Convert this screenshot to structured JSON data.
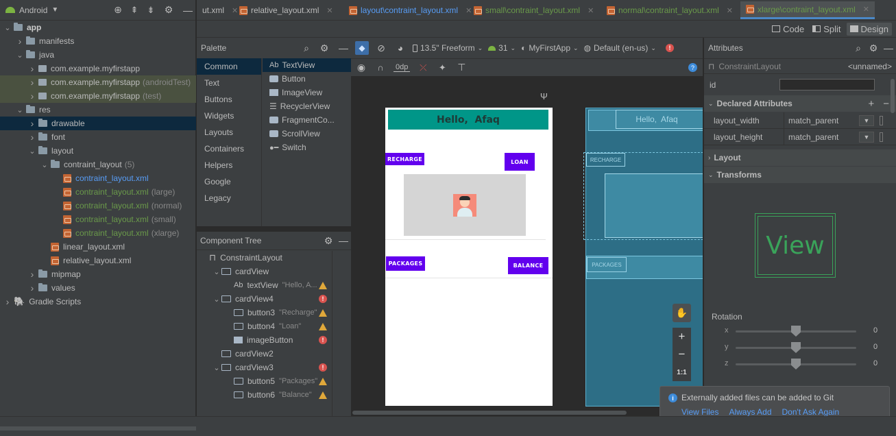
{
  "project": {
    "view": "Android",
    "tree": [
      {
        "label": "app",
        "d": 0,
        "arrow": "v",
        "icon": "folder",
        "bold": true
      },
      {
        "label": "manifests",
        "d": 1,
        "arrow": ">",
        "icon": "folder"
      },
      {
        "label": "java",
        "d": 1,
        "arrow": "v",
        "icon": "folder"
      },
      {
        "label": "com.example.myfirstapp",
        "d": 2,
        "arrow": ">",
        "icon": "pkg"
      },
      {
        "label": "com.example.myfirstapp",
        "suffix": "(androidTest)",
        "d": 2,
        "arrow": ">",
        "icon": "pkg",
        "hl": "test"
      },
      {
        "label": "com.example.myfirstapp",
        "suffix": "(test)",
        "d": 2,
        "arrow": ">",
        "icon": "pkg",
        "hl": "test"
      },
      {
        "label": "res",
        "d": 1,
        "arrow": "v",
        "icon": "folder"
      },
      {
        "label": "drawable",
        "d": 2,
        "arrow": ">",
        "icon": "folder",
        "hl": "sel"
      },
      {
        "label": "font",
        "d": 2,
        "arrow": ">",
        "icon": "folder"
      },
      {
        "label": "layout",
        "d": 2,
        "arrow": "v",
        "icon": "folder"
      },
      {
        "label": "contraint_layout",
        "suffix": "(5)",
        "d": 3,
        "arrow": "v",
        "icon": "folder"
      },
      {
        "label": "contraint_layout.xml",
        "d": 4,
        "arrow": "",
        "icon": "xml",
        "color": "blue"
      },
      {
        "label": "contraint_layout.xml",
        "suffix": "(large)",
        "d": 4,
        "arrow": "",
        "icon": "xml",
        "color": "green"
      },
      {
        "label": "contraint_layout.xml",
        "suffix": "(normal)",
        "d": 4,
        "arrow": "",
        "icon": "xml",
        "color": "green"
      },
      {
        "label": "contraint_layout.xml",
        "suffix": "(small)",
        "d": 4,
        "arrow": "",
        "icon": "xml",
        "color": "green"
      },
      {
        "label": "contraint_layout.xml",
        "suffix": "(xlarge)",
        "d": 4,
        "arrow": "",
        "icon": "xml",
        "color": "green"
      },
      {
        "label": "linear_layout.xml",
        "d": 3,
        "arrow": "",
        "icon": "xml"
      },
      {
        "label": "relative_layout.xml",
        "d": 3,
        "arrow": "",
        "icon": "xml"
      },
      {
        "label": "mipmap",
        "d": 2,
        "arrow": ">",
        "icon": "folder"
      },
      {
        "label": "values",
        "d": 2,
        "arrow": ">",
        "icon": "folder"
      },
      {
        "label": "Gradle Scripts",
        "d": 0,
        "arrow": ">",
        "icon": "gradle"
      }
    ]
  },
  "tabs": [
    {
      "label": "ut.xml",
      "color": "#bbbbbb"
    },
    {
      "label": "relative_layout.xml",
      "color": "#bbbbbb"
    },
    {
      "label": "layout\\contraint_layout.xml",
      "color": "#589df6"
    },
    {
      "label": "small\\contraint_layout.xml",
      "color": "#6a9a4a"
    },
    {
      "label": "normal\\contraint_layout.xml",
      "color": "#6a9a4a"
    },
    {
      "label": "xlarge\\contraint_layout.xml",
      "color": "#6a9a4a",
      "active": true
    }
  ],
  "modes": {
    "code": "Code",
    "split": "Split",
    "design": "Design"
  },
  "palette": {
    "title": "Palette",
    "categories": [
      "Common",
      "Text",
      "Buttons",
      "Widgets",
      "Layouts",
      "Containers",
      "Helpers",
      "Google",
      "Legacy"
    ],
    "items": [
      "TextView",
      "Button",
      "ImageView",
      "RecyclerView",
      "FragmentCo...",
      "ScrollView",
      "Switch"
    ],
    "textview_prefix": "Ab"
  },
  "toolbar": {
    "device": "13.5\" Freeform",
    "api": "31",
    "app": "MyFirstApp",
    "locale": "Default (en-us)",
    "margin": "0dp"
  },
  "component_tree": {
    "title": "Component Tree",
    "items": [
      {
        "label": "ConstraintLayout",
        "d": 0,
        "arrow": "",
        "icon": "cl"
      },
      {
        "label": "cardView",
        "d": 1,
        "arrow": "v",
        "icon": "box"
      },
      {
        "label": "textView",
        "hint": "\"Hello, A...",
        "d": 2,
        "arrow": "",
        "icon": "ab",
        "status": "warn"
      },
      {
        "label": "cardView4",
        "d": 1,
        "arrow": "v",
        "icon": "box",
        "status": "err"
      },
      {
        "label": "button3",
        "hint": "\"Recharge\"",
        "d": 2,
        "arrow": "",
        "icon": "box",
        "status": "warn"
      },
      {
        "label": "button4",
        "hint": "\"Loan\"",
        "d": 2,
        "arrow": "",
        "icon": "box",
        "status": "warn"
      },
      {
        "label": "imageButton",
        "d": 2,
        "arrow": "",
        "icon": "img",
        "status": "err"
      },
      {
        "label": "cardView2",
        "d": 1,
        "arrow": "",
        "icon": "box"
      },
      {
        "label": "cardView3",
        "d": 1,
        "arrow": "v",
        "icon": "box",
        "status": "err"
      },
      {
        "label": "button5",
        "hint": "\"Packages\"",
        "d": 2,
        "arrow": "",
        "icon": "box",
        "status": "warn"
      },
      {
        "label": "button6",
        "hint": "\"Balance\"",
        "d": 2,
        "arrow": "",
        "icon": "box",
        "status": "warn"
      }
    ]
  },
  "design": {
    "hello": "Hello,  Afaq",
    "recharge": "RECHARGE",
    "loan": "LOAN",
    "packages": "PACKAGES",
    "balance": "BALANCE",
    "bp_hello": "Hello,  Afaq",
    "bp_recharge": "RECHARGE",
    "bp_packages": "PACKAGES",
    "zoom_fit": "1:1"
  },
  "attributes": {
    "title": "Attributes",
    "component": "ConstraintLayout",
    "unnamed": "<unnamed>",
    "id_label": "id",
    "declared": "Declared Attributes",
    "rows": [
      {
        "name": "layout_width",
        "value": "match_parent"
      },
      {
        "name": "layout_height",
        "value": "match_parent"
      }
    ],
    "layout": "Layout",
    "transforms": "Transforms",
    "view_text": "View",
    "rotation": "Rotation",
    "axes": [
      {
        "axis": "x",
        "value": "0"
      },
      {
        "axis": "y",
        "value": "0"
      },
      {
        "axis": "z",
        "value": "0"
      }
    ]
  },
  "notification": {
    "message": "Externally added files can be added to Git",
    "actions": [
      "View Files",
      "Always Add",
      "Don't Ask Again"
    ]
  },
  "colors": {
    "accent": "#589df6",
    "purple": "#6200ee",
    "teal": "#009688",
    "blueprint": "#2d6e86"
  }
}
